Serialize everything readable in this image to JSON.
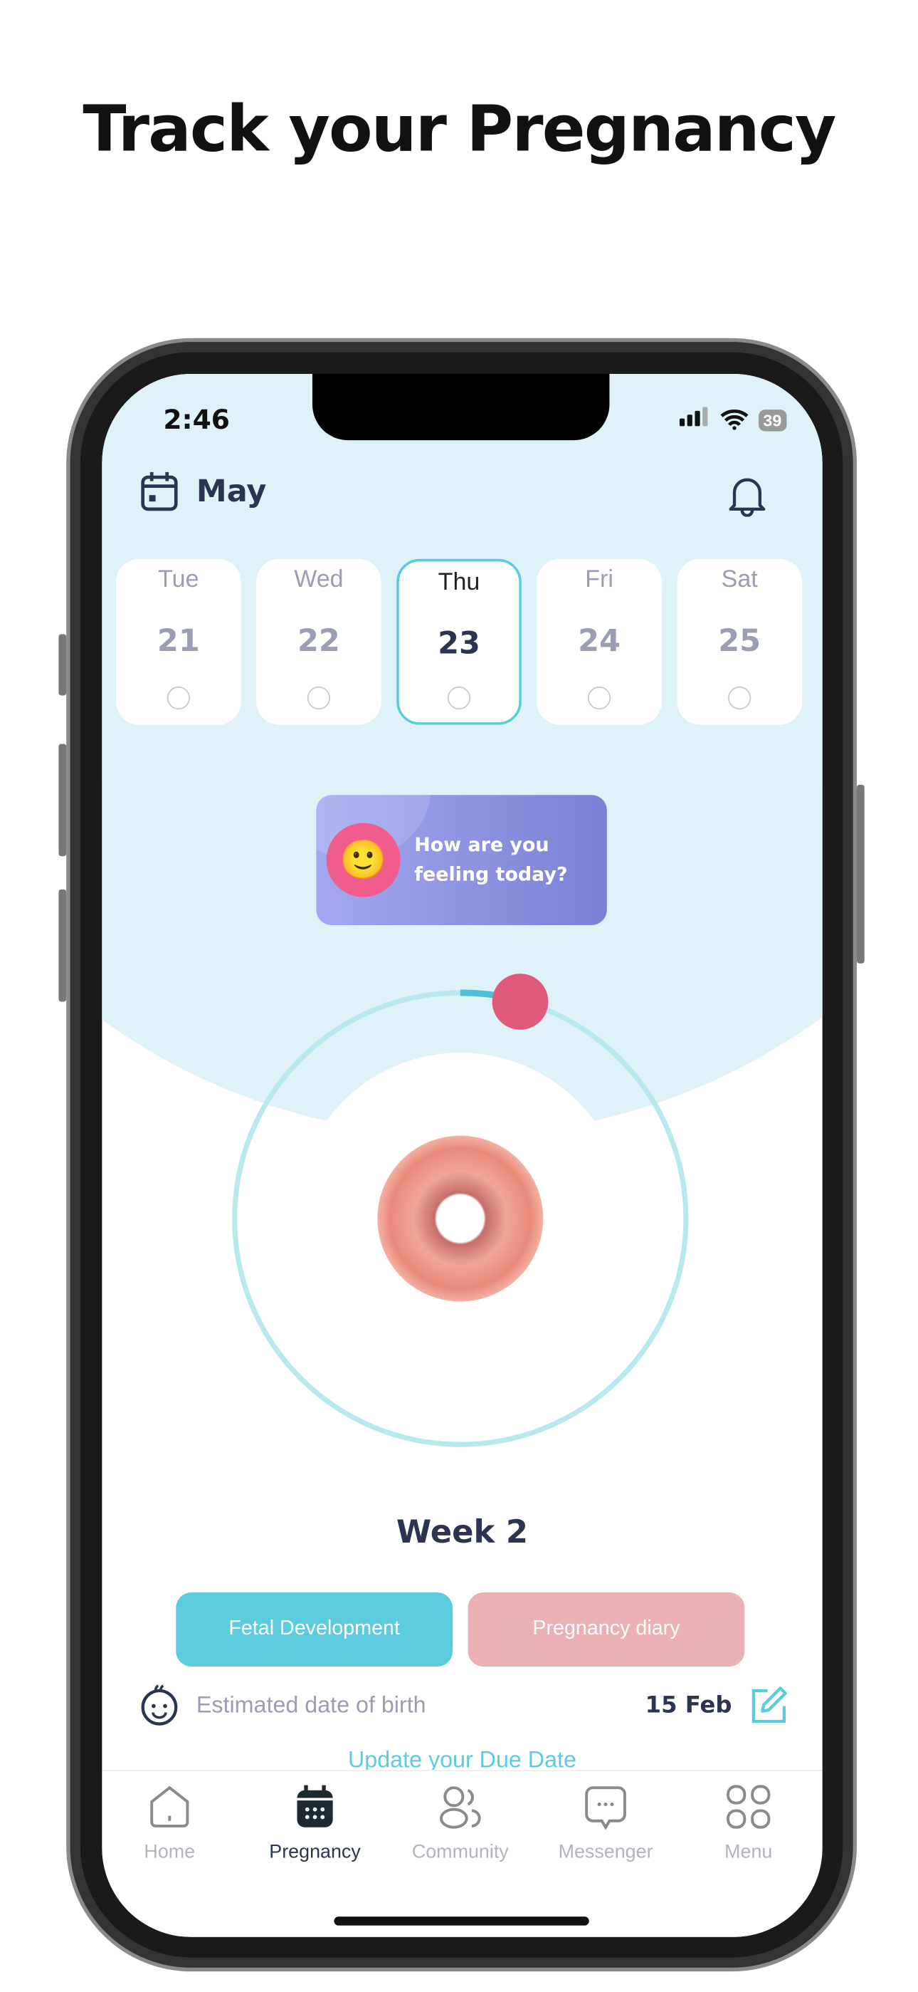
{
  "headline": "Track your Pregnancy",
  "status": {
    "time": "2:46",
    "battery": "39"
  },
  "header": {
    "month": "May"
  },
  "days": [
    {
      "name": "Tue",
      "num": "21"
    },
    {
      "name": "Wed",
      "num": "22"
    },
    {
      "name": "Thu",
      "num": "23",
      "selected": true
    },
    {
      "name": "Fri",
      "num": "24"
    },
    {
      "name": "Sat",
      "num": "25"
    }
  ],
  "mood_card": {
    "text": "How are you feeling today?",
    "icon": "smiley-on-hand-icon"
  },
  "progress": {
    "week": "Week 2"
  },
  "buttons": {
    "fetal": "Fetal Development",
    "diary": "Pregnancy diary"
  },
  "due": {
    "label": "Estimated date of birth",
    "value": "15 Feb",
    "update_link": "Update your Due Date"
  },
  "nav": [
    {
      "label": "Home",
      "icon": "home-icon"
    },
    {
      "label": "Pregnancy",
      "icon": "calendar-icon",
      "active": true
    },
    {
      "label": "Community",
      "icon": "people-icon"
    },
    {
      "label": "Messenger",
      "icon": "chat-icon"
    },
    {
      "label": "Menu",
      "icon": "grid-icon"
    }
  ],
  "colors": {
    "accent": "#5ccbdd",
    "pink": "#ebb0b3",
    "navy": "#2b3450",
    "background": "#def2f7",
    "marker": "#e05a7e"
  }
}
